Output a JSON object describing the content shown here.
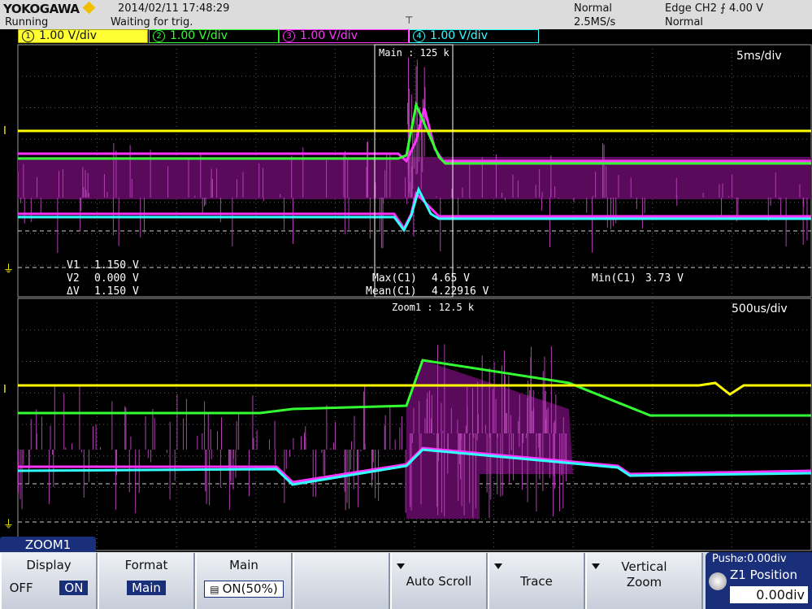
{
  "header": {
    "brand": "YOKOGAWA",
    "status": "Running",
    "datetime": "2014/02/11 17:48:29",
    "trigger_state": "Waiting for trig.",
    "acq_mode": "Normal",
    "sample_rate": "2.5MS/s",
    "trigger_setting": "Edge CH2 ⨍ 4.00 V",
    "trigger_mode": "Normal"
  },
  "channels": [
    {
      "num": "1",
      "label": "1.00 V/div",
      "color": "#ffff00"
    },
    {
      "num": "2",
      "label": "1.00 V/div",
      "color": "#33ff33"
    },
    {
      "num": "3",
      "label": "1.00 V/div",
      "color": "#ff33ff"
    },
    {
      "num": "4",
      "label": "1.00 V/div",
      "color": "#33ffff"
    }
  ],
  "main_pane": {
    "record_label": "Main : 125 k",
    "timebase": "5ms/div",
    "cursors": {
      "v1_label": "V1",
      "v1": "1.150 V",
      "v2_label": "V2",
      "v2": "0.000 V",
      "dv_label": "ΔV",
      "dv": "1.150 V"
    },
    "measurements": {
      "max_label": "Max(C1)",
      "max": "4.65 V",
      "mean_label": "Mean(C1)",
      "mean": "4.22916 V",
      "min_label": "Min(C1)",
      "min": "3.73 V"
    }
  },
  "zoom_pane": {
    "record_label": "Zoom1 : 12.5 k",
    "timebase": "500us/div"
  },
  "menu": {
    "tab": "ZOOM1",
    "display": {
      "title": "Display",
      "off": "OFF",
      "on": "ON"
    },
    "format": {
      "title": "Format",
      "value": "Main"
    },
    "main": {
      "title": "Main",
      "value": "ON(50%)"
    },
    "auto_scroll": "Auto Scroll",
    "trace": "Trace",
    "vertical_zoom_1": "Vertical",
    "vertical_zoom_2": "Zoom",
    "position_hint": "Push⌀:0.00div",
    "position_title": "Z1 Position",
    "position_value": "0.00div"
  },
  "colors": {
    "ch1": "#ffff00",
    "ch2": "#33ff33",
    "ch3": "#ff33ff",
    "ch4": "#33ffff",
    "fill": "#5a0a5a",
    "accent": "#1a2f7a"
  }
}
